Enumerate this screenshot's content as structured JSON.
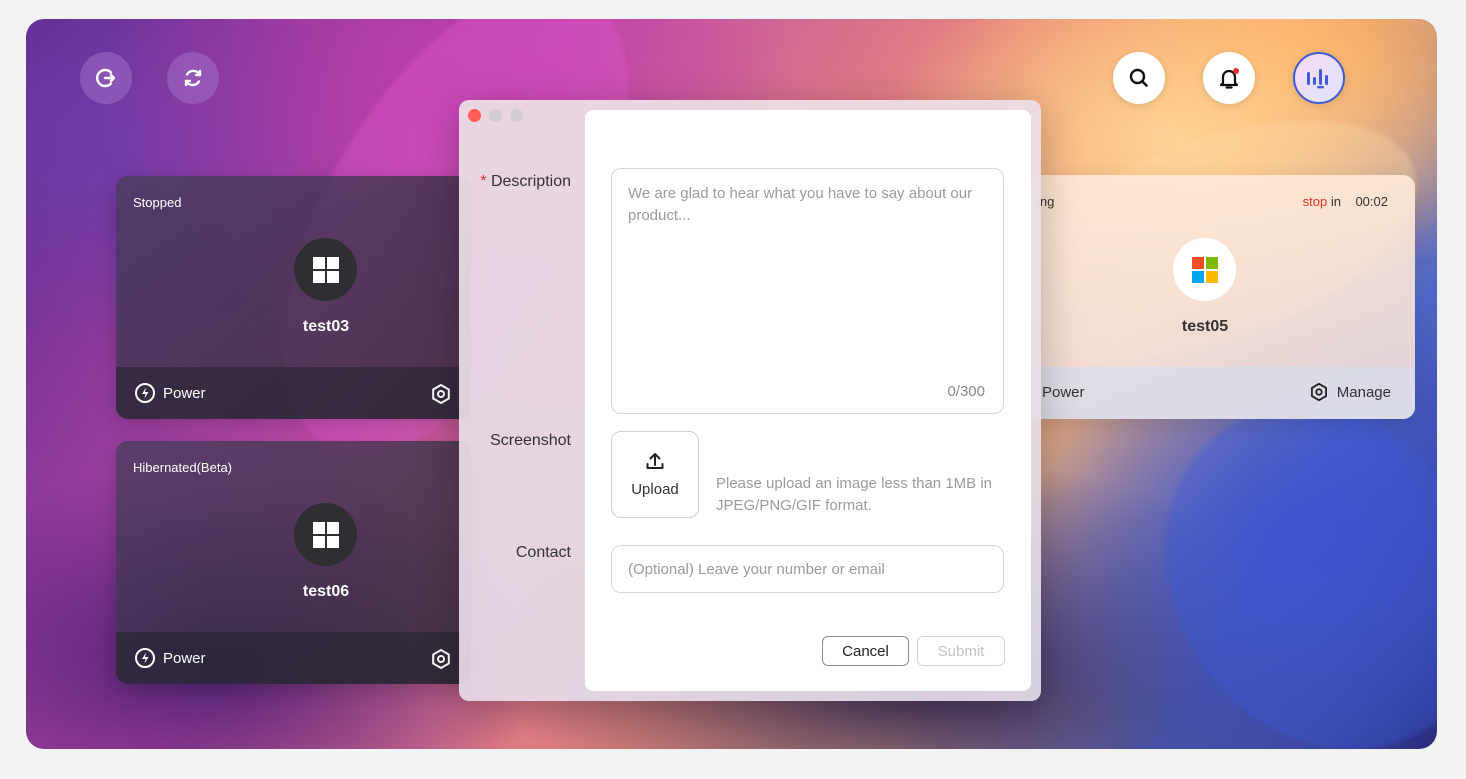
{
  "toolbar": {
    "left_icons": [
      "logout-icon",
      "refresh-icon"
    ],
    "right_icons": [
      "search-icon",
      "bell-icon",
      "voice-assistant-icon"
    ],
    "notification_dot_color": "#e5322d"
  },
  "cards": [
    {
      "state": "Stopped",
      "name": "test03",
      "os_icon": "windows-icon",
      "power_label": "Power"
    },
    {
      "state": "Hibernated(Beta)",
      "name": "test06",
      "os_icon": "windows-icon",
      "power_label": "Power"
    }
  ],
  "running_card": {
    "state": "ing",
    "timer_stop": "stop",
    "timer_in": "in",
    "timer_value": "00:02",
    "name": "test05",
    "os_icon": "microsoft-logo-icon",
    "power_label": "Power",
    "manage_label": "Manage"
  },
  "dialog": {
    "labels": {
      "required_mark": "*",
      "description": "Description",
      "screenshot": "Screenshot",
      "contact": "Contact"
    },
    "description_placeholder": "We are glad to hear what you have to say about our product...",
    "description_value": "",
    "counter": "0/300",
    "upload_label": "Upload",
    "upload_hint": "Please upload an image less than 1MB in JPEG/PNG/GIF format.",
    "contact_placeholder": "(Optional) Leave your number or email",
    "contact_value": "",
    "cancel_label": "Cancel",
    "submit_label": "Submit"
  },
  "colors": {
    "accent_red": "#e5322d",
    "voice_icon_blue": "#3d5bd9"
  }
}
